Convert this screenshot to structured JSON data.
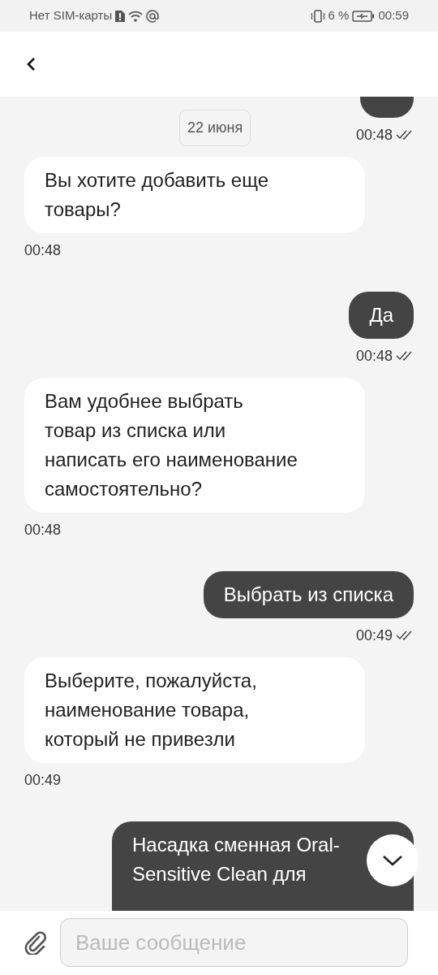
{
  "status_bar": {
    "carrier": "Нет SIM-карты",
    "battery": "6 %",
    "time": "00:59"
  },
  "date_chip": "22 июня",
  "messages": [
    {
      "kind": "outgoing",
      "cut_top": true,
      "time": "00:48",
      "read": true
    },
    {
      "kind": "incoming",
      "text": "Вы хотите добавить еще\nтовары?",
      "time": "00:48"
    },
    {
      "kind": "outgoing",
      "text": "Да",
      "time": "00:48",
      "read": true
    },
    {
      "kind": "incoming",
      "text": "Вам удобнее выбрать\nтовар из списка или\nнаписать его наименование\nсамостоятельно?",
      "time": "00:48"
    },
    {
      "kind": "outgoing",
      "text": "Выбрать из списка",
      "time": "00:49",
      "read": true
    },
    {
      "kind": "incoming",
      "text": "Выберите, пожалуйста,\nнаименование товара,\nкоторый не привезли",
      "time": "00:49"
    },
    {
      "kind": "outgoing",
      "cut_bottom": true,
      "text": "Насадка сменная Oral-\nSensitive Clean для"
    }
  ],
  "composer": {
    "placeholder": "Ваше сообщение"
  }
}
